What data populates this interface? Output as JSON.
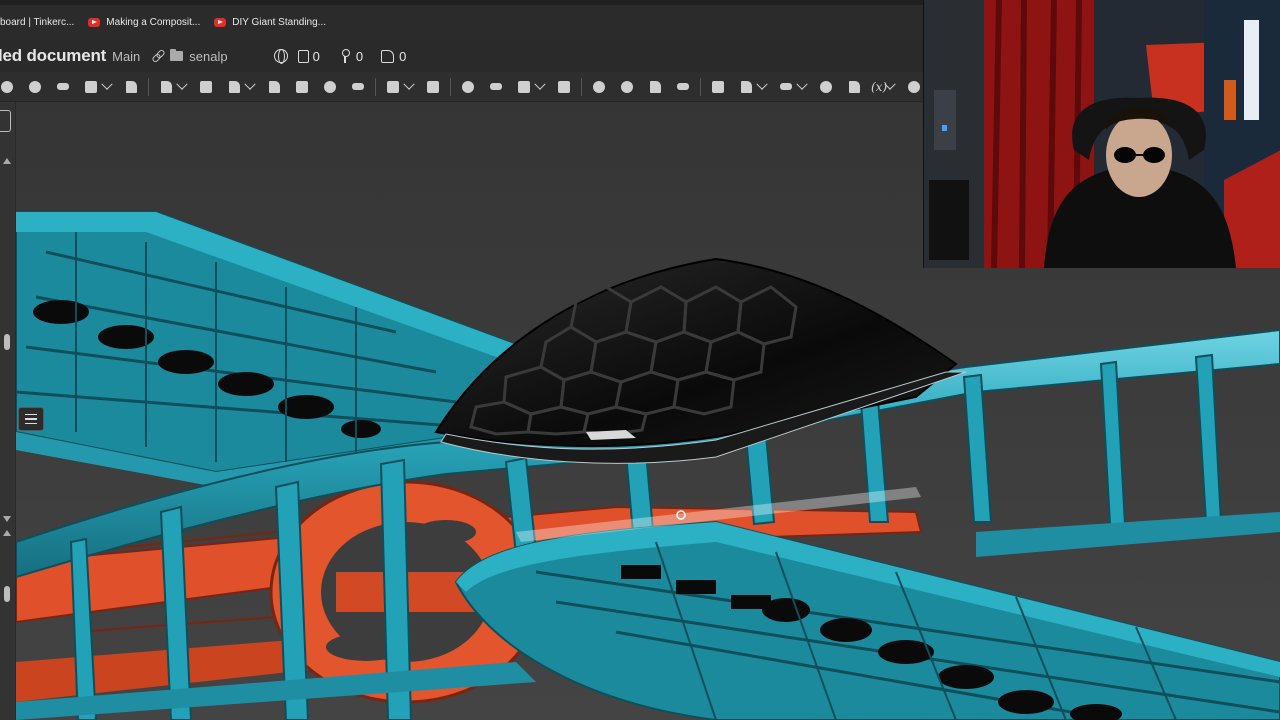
{
  "bookmarks": [
    {
      "label": "board | Tinkerc...",
      "icon": "tinkercad-icon"
    },
    {
      "label": "Making a Composit...",
      "icon": "youtube-icon"
    },
    {
      "label": "DIY Giant Standing...",
      "icon": "youtube-icon"
    }
  ],
  "document": {
    "title": "led document",
    "branch": "Main",
    "owner": "senalp",
    "copies": "0",
    "versions": "0",
    "likes": "0"
  },
  "toolbar": {
    "variable_label": "(x)"
  },
  "viewport": {
    "model": "rc-airplane-cad-model",
    "colors": {
      "frame": "#1f9bb0",
      "fuselage_core": "#e0502a",
      "canopy": "#0d0d0d",
      "background": "#3d3d3d"
    }
  },
  "webcam": {
    "subject": "person-wearing-sunglasses"
  }
}
